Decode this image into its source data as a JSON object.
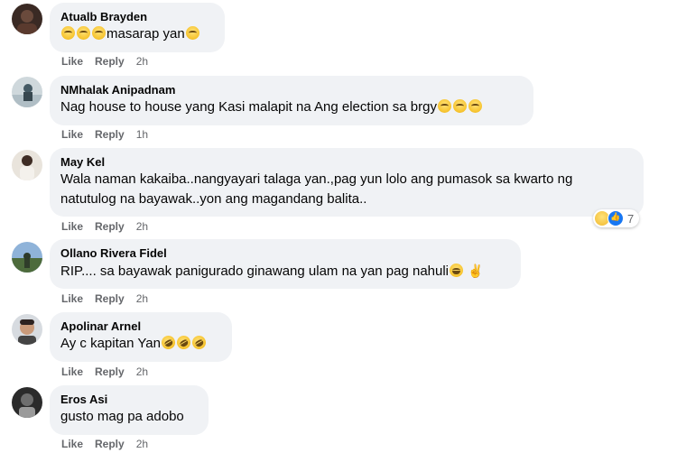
{
  "actions": {
    "like": "Like",
    "reply": "Reply"
  },
  "comments": [
    {
      "author": "Atualb Brayden",
      "text": "masarap yan",
      "time": "2h"
    },
    {
      "author": "NMhalak Anipadnam",
      "text": "Nag house to house yang Kasi malapit na Ang election sa brgy",
      "time": "1h"
    },
    {
      "author": "May Kel",
      "text_line1": "Wala naman kakaiba..nangyayari talaga yan.,pag yun lolo ang pumasok sa kwarto ng",
      "text_line2": "natutulog na bayawak..yon ang magandang balita..",
      "time": "2h",
      "reaction_count": "7"
    },
    {
      "author": "Ollano Rivera Fidel",
      "text": "RIP.... sa bayawak panigurado ginawang ulam na yan pag nahuli",
      "time": "2h"
    },
    {
      "author": "Apolinar Arnel",
      "text": "Ay c kapitan Yan",
      "time": "2h"
    },
    {
      "author": "Eros Asi",
      "text": "gusto mag pa adobo",
      "time": "2h"
    }
  ]
}
